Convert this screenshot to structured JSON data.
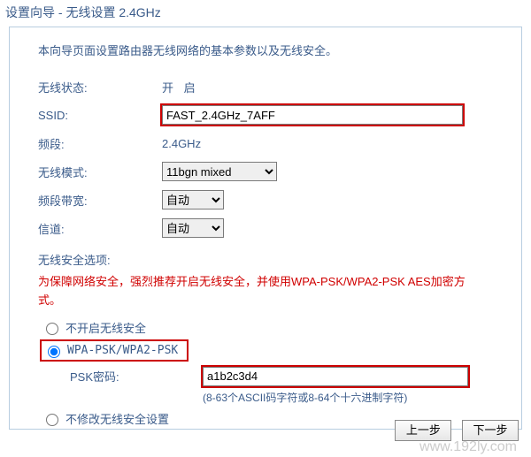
{
  "title": "设置向导 - 无线设置 2.4GHz",
  "description": "本向导页面设置路由器无线网络的基本参数以及无线安全。",
  "fields": {
    "status_label": "无线状态:",
    "status_value": "开 启",
    "ssid_label": "SSID:",
    "ssid_value": "FAST_2.4GHz_7AFF",
    "band_label": "频段:",
    "band_value": "2.4GHz",
    "mode_label": "无线模式:",
    "mode_value": "11bgn mixed",
    "bw_label": "频段带宽:",
    "bw_value": "自动",
    "ch_label": "信道:",
    "ch_value": "自动"
  },
  "security": {
    "label": "无线安全选项:",
    "warn": "为保障网络安全，强烈推荐开启无线安全，并使用WPA-PSK/WPA2-PSK AES加密方式。",
    "opt_none": "不开启无线安全",
    "opt_wpa": "WPA-PSK/WPA2-PSK",
    "psk_label": "PSK密码:",
    "psk_value": "a1b2c3d4",
    "psk_hint": "(8-63个ASCII码字符或8-64个十六进制字符)",
    "opt_keep": "不修改无线安全设置"
  },
  "buttons": {
    "prev": "上一步",
    "next": "下一步"
  },
  "watermark": "www.192ly.com"
}
